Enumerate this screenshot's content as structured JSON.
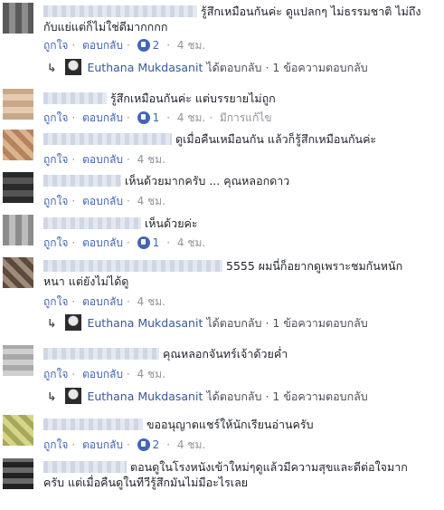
{
  "ui": {
    "like": "ถูกใจ",
    "reply": "ตอบกลับ",
    "dot": "·"
  },
  "comments": [
    {
      "lines": [
        "รู้สึกเหมือนกันค่ะ ดูแปลกๆ ไม่ธรรมชาติ ไม่ถึง",
        "กับแย่แต่ก็ไม่ใช่ดีมากกกก"
      ],
      "likes": "2",
      "time": "4 ชม.",
      "edited": ""
    },
    {
      "lines": [
        "รู้สึกเหมือนกันค่ะ แต่บรรยายไม่ถูก"
      ],
      "likes": "1",
      "time": "4 ชม.",
      "edited": "มีการแก้ไข"
    },
    {
      "lines": [
        "ดูเมื่อคืนเหมือนกัน แล้วก็รู้สึกเหมือนกันค่ะ"
      ],
      "likes": "",
      "time": "4 ชม.",
      "edited": ""
    },
    {
      "lines": [
        "เห็นด้วยมากครับ ... คุณหลอกดาว"
      ],
      "likes": "",
      "time": "4 ชม.",
      "edited": ""
    },
    {
      "lines": [
        "เห็นด้วยค่ะ"
      ],
      "likes": "1",
      "time": "4 ชม.",
      "edited": ""
    },
    {
      "lines": [
        "5555 ผมนี่ก็อยากดูเพราะชมกันหนัก",
        "หนา แต่ยังไม่ได้ดู"
      ],
      "likes": "",
      "time": "4 ชม.",
      "edited": ""
    },
    {
      "lines": [
        "คุณหลอกจันทร์เจ้าด้วยค่ำ"
      ],
      "likes": "",
      "time": "4 ชม.",
      "edited": ""
    },
    {
      "lines": [
        "ขออนุญาตแชร์ให้นักเรียนอ่านครับ"
      ],
      "likes": "2",
      "time": "4 ชม.",
      "edited": ""
    },
    {
      "lines": [
        "ตอนดูในโรงหนังเข้าใหม่ๆดูแล้วมีความสุขและดีต่อใจมาก",
        "ครับ แต่เมื่อคืนดูในทีวีรู้สึกมันไม่มีอะไรเลย"
      ],
      "likes": "",
      "time": "",
      "edited": ""
    }
  ],
  "replies": [
    {
      "name": "Euthana Mukdasanit",
      "text": "ได้ตอบกลับ · 1 ข้อความตอบกลับ"
    },
    {
      "name": "Euthana Mukdasanit",
      "text": "ได้ตอบกลับ · 1 ข้อความตอบกลับ"
    },
    {
      "name": "Euthana Mukdasanit",
      "text": "ได้ตอบกลับ · 1 ข้อความตอบกลับ"
    }
  ]
}
